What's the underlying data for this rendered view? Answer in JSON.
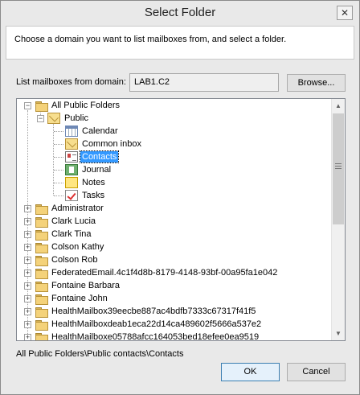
{
  "dialog": {
    "title": "Select Folder",
    "close_glyph": "✕",
    "instruction": "Choose a domain you want to list mailboxes from, and select a folder.",
    "domain_label": "List mailboxes from domain:",
    "domain_value": "LAB1.C2",
    "browse_label": "Browse...",
    "selected_path": "All Public Folders\\Public contacts\\Contacts",
    "ok_label": "OK",
    "cancel_label": "Cancel"
  },
  "tree": {
    "root": {
      "label": "All Public Folders",
      "icon": "folder-icon",
      "expanded": true
    },
    "public": {
      "label": "Public",
      "icon": "open-folder-icon",
      "expanded": true
    },
    "public_children": [
      {
        "label": "Calendar",
        "icon": "calendar-icon"
      },
      {
        "label": "Common inbox",
        "icon": "envelope-icon"
      },
      {
        "label": "Contacts",
        "icon": "contacts-icon",
        "selected": true
      },
      {
        "label": "Journal",
        "icon": "journal-icon"
      },
      {
        "label": "Notes",
        "icon": "notes-icon"
      },
      {
        "label": "Tasks",
        "icon": "tasks-icon"
      }
    ],
    "mailboxes": [
      {
        "label": "Administrator"
      },
      {
        "label": "Clark Lucia"
      },
      {
        "label": "Clark Tina"
      },
      {
        "label": "Colson Kathy"
      },
      {
        "label": "Colson Rob"
      },
      {
        "label": "FederatedEmail.4c1f4d8b-8179-4148-93bf-00a95fa1e042"
      },
      {
        "label": "Fontaine Barbara"
      },
      {
        "label": "Fontaine John"
      },
      {
        "label": "HealthMailbox39eecbe887ac4bdfb7333c67317f41f5"
      },
      {
        "label": "HealthMailboxdeab1eca22d14ca489602f5666a537e2"
      },
      {
        "label": "HealthMailboxe05788afcc164053bed18efee0ea9519"
      }
    ],
    "expander_collapsed": "+",
    "expander_expanded": "−"
  },
  "scrollbar": {
    "up_glyph": "▲",
    "down_glyph": "▼"
  }
}
